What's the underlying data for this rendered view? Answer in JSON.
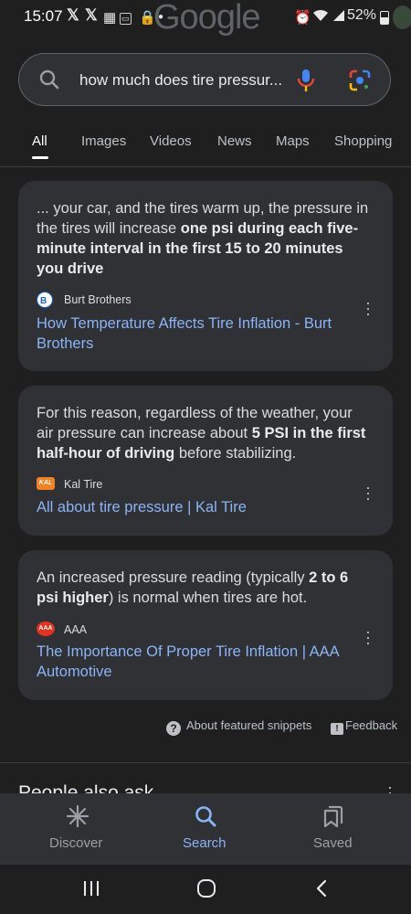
{
  "status_bar": {
    "time": "15:07",
    "battery": "52%",
    "logo": "Google"
  },
  "search": {
    "query": "how much does tire pressur..."
  },
  "tabs": [
    {
      "label": "All"
    },
    {
      "label": "Images"
    },
    {
      "label": "Videos"
    },
    {
      "label": "News"
    },
    {
      "label": "Maps"
    },
    {
      "label": "Shopping"
    }
  ],
  "results": [
    {
      "snippet_plain": "... your car, and the tires warm up, the pressure in the tires will increase ",
      "snippet_bold": "one psi during each five-minute interval in the first 15 to 20 minutes you drive",
      "snippet_after": "",
      "source": "Burt Brothers",
      "title": "How Temperature Affects Tire Inflation - Burt Brothers"
    },
    {
      "snippet_plain": "For this reason, regardless of the weather, your air pressure can increase about ",
      "snippet_bold": "5 PSI in the first half-hour of driving",
      "snippet_after": " before stabilizing.",
      "source": "Kal Tire",
      "title": "All about tire pressure | Kal Tire"
    },
    {
      "snippet_plain": "An increased pressure reading (typically ",
      "snippet_bold": "2 to 6 psi higher",
      "snippet_after": ") is normal when tires are hot.",
      "source": "AAA",
      "title": "The Importance Of Proper Tire Inflation | AAA Automotive"
    }
  ],
  "footer": {
    "about": "About featured snippets",
    "feedback": "Feedback"
  },
  "paa": {
    "title": "People also ask"
  },
  "bottom_nav": {
    "discover": "Discover",
    "search": "Search",
    "saved": "Saved"
  },
  "colors": {
    "accent": "#8ab4f8",
    "card": "#303134",
    "background": "#1f1f1f"
  }
}
